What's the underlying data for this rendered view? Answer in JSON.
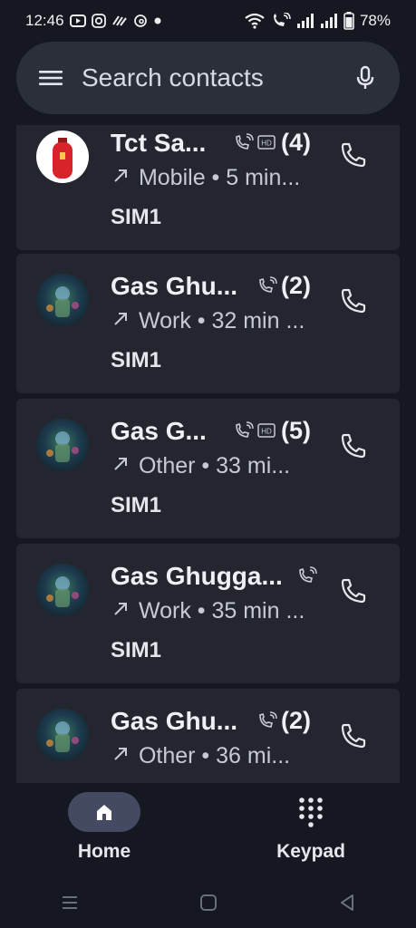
{
  "status_bar": {
    "time": "12:46",
    "battery": "78%"
  },
  "search": {
    "placeholder": "Search contacts"
  },
  "calls": [
    {
      "name": "Tct Sa...",
      "count": "(4)",
      "has_hd": true,
      "detail": "Mobile • 5 min...",
      "sim": "SIM1",
      "avatar": "gas-cylinder"
    },
    {
      "name": "Gas Ghu...",
      "count": "(2)",
      "has_hd": false,
      "detail": "Work • 32 min ...",
      "sim": "SIM1",
      "avatar": "deity"
    },
    {
      "name": "Gas G...",
      "count": "(5)",
      "has_hd": true,
      "detail": "Other • 33 mi...",
      "sim": "SIM1",
      "avatar": "deity"
    },
    {
      "name": "Gas Ghugga...",
      "count": "",
      "has_hd": false,
      "detail": "Work • 35 min ...",
      "sim": "SIM1",
      "avatar": "deity"
    },
    {
      "name": "Gas Ghu...",
      "count": "(2)",
      "has_hd": false,
      "detail": "Other • 36 mi...",
      "sim": "",
      "avatar": "deity"
    }
  ],
  "bottom_nav": {
    "home_label": "Home",
    "keypad_label": "Keypad"
  },
  "colors": {
    "background": "#151821",
    "card": "#23262f",
    "search": "#2b2f3a",
    "nav_pill": "#454a63"
  }
}
